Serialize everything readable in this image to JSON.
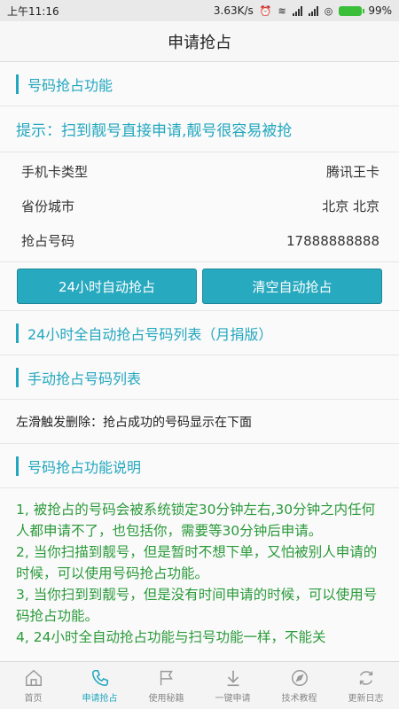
{
  "statusbar": {
    "time": "上午11:16",
    "speed": "3.63K/s",
    "battery": "99%"
  },
  "header": {
    "title": "申请抢占"
  },
  "sections": {
    "grab_feature": "号码抢占功能",
    "tip": "提示：扫到靓号直接申请,靓号很容易被抢",
    "fields": [
      {
        "label": "手机卡类型",
        "value": "腾讯王卡"
      },
      {
        "label": "省份城市",
        "value": "北京 北京"
      },
      {
        "label": "抢占号码",
        "value": "17888888888"
      }
    ],
    "buttons": {
      "auto_grab": "24小时自动抢占",
      "clear_auto": "清空自动抢占"
    },
    "auto_list": "24小时全自动抢占号码列表（月捐版）",
    "manual_list": "手动抢占号码列表",
    "swipe_note": "左滑触发删除：抢占成功的号码显示在下面",
    "explain_title": "号码抢占功能说明",
    "explain_lines": [
      "1, 被抢占的号码会被系统锁定30分钟左右,30分钟之内任何人都申请不了，也包括你，需要等30分钟后申请。",
      "2, 当你扫描到靓号，但是暂时不想下单，又怕被别人申请的时候，可以使用号码抢占功能。",
      "3, 当你扫到到靓号，但是没有时间申请的时候，可以使用号码抢占功能。",
      "4, 24小时全自动抢占功能与扫号功能一样，不能关"
    ]
  },
  "bottomnav": [
    {
      "label": "首页",
      "icon": "home-icon"
    },
    {
      "label": "申请抢占",
      "icon": "phone-icon"
    },
    {
      "label": "使用秘籍",
      "icon": "flag-icon"
    },
    {
      "label": "一键申请",
      "icon": "download-icon"
    },
    {
      "label": "技术教程",
      "icon": "compass-icon"
    },
    {
      "label": "更新日志",
      "icon": "refresh-icon"
    }
  ],
  "colors": {
    "accent": "#23a7bf",
    "button": "#27a9bf",
    "explain_text": "#2a9a3a"
  }
}
